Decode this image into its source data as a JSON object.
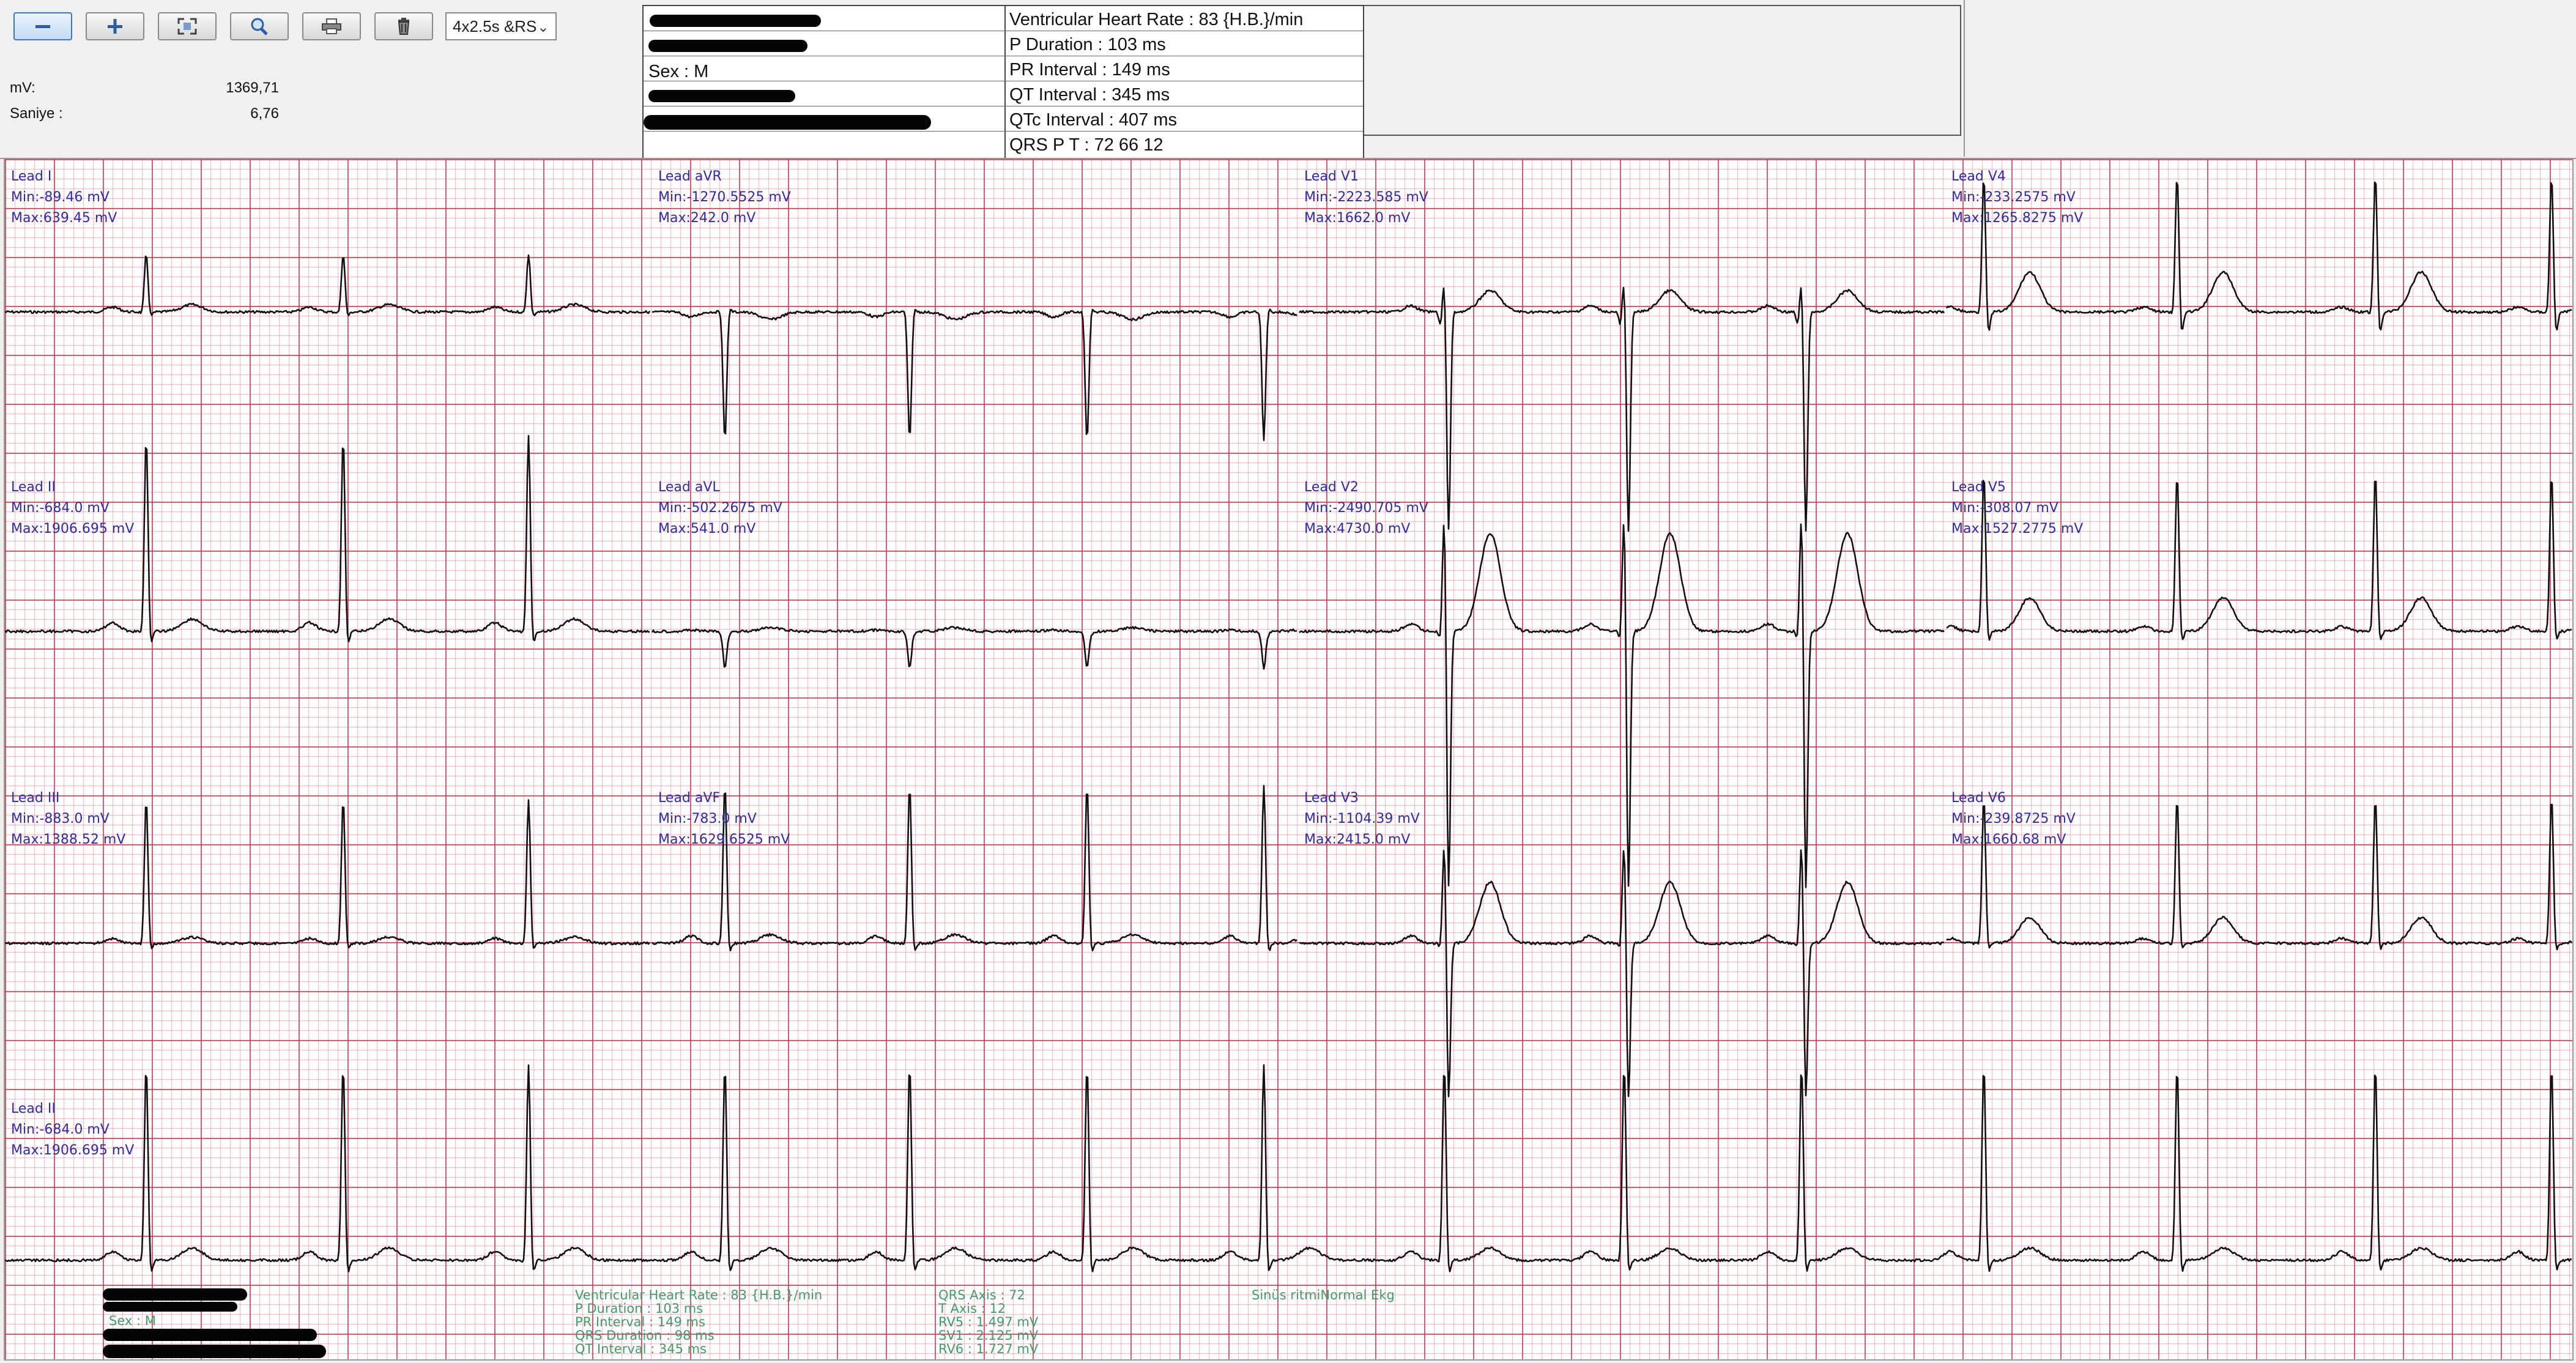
{
  "toolbar": {
    "buttons": [
      {
        "name": "zoom-out-button",
        "icon": "minus-icon"
      },
      {
        "name": "zoom-in-button",
        "icon": "plus-icon"
      },
      {
        "name": "fit-screen-button",
        "icon": "fullscreen-icon"
      },
      {
        "name": "magnify-button",
        "icon": "magnifier-icon"
      },
      {
        "name": "print-button",
        "icon": "printer-icon"
      },
      {
        "name": "delete-button",
        "icon": "trash-icon"
      }
    ],
    "layout_select": "4x2.5s &RS"
  },
  "stats": {
    "mv_label": "mV:",
    "mv_value": "1369,71",
    "saniye_label": "Saniye :",
    "saniye_value": "6,76"
  },
  "info_panel": {
    "sex": "Sex : M",
    "ventricular_rate": "Ventricular Heart Rate : 83 {H.B.}/min",
    "p_duration": "P Duration : 103 ms",
    "pr_interval": "PR Interval : 149 ms",
    "qt_interval": "QT Interval : 345 ms",
    "qtc_interval": "QTc Interval : 407 ms",
    "qrs_pt": "QRS  P  T  : 72  66  12"
  },
  "leads": [
    {
      "label": "Lead I",
      "min": "Min:-89.46 mV",
      "max": "Max:639.45 mV"
    },
    {
      "label": "Lead aVR",
      "min": "Min:-1270.5525 mV",
      "max": "Max:242.0 mV"
    },
    {
      "label": "Lead V1",
      "min": "Min:-2223.585 mV",
      "max": "Max:1662.0 mV"
    },
    {
      "label": "Lead V4",
      "min": "Min:-233.2575 mV",
      "max": "Max:1265.8275 mV"
    },
    {
      "label": "Lead II",
      "min": "Min:-684.0 mV",
      "max": "Max:1906.695 mV"
    },
    {
      "label": "Lead aVL",
      "min": "Min:-502.2675 mV",
      "max": "Max:541.0 mV"
    },
    {
      "label": "Lead V2",
      "min": "Min:-2490.705 mV",
      "max": "Max:4730.0 mV"
    },
    {
      "label": "Lead V5",
      "min": "Min:-308.07 mV",
      "max": "Max:1527.2775 mV"
    },
    {
      "label": "Lead III",
      "min": "Min:-883.0 mV",
      "max": "Max:1388.52 mV"
    },
    {
      "label": "Lead aVF",
      "min": "Min:-783.0 mV",
      "max": "Max:1629.6525 mV"
    },
    {
      "label": "Lead V3",
      "min": "Min:-1104.39 mV",
      "max": "Max:2415.0 mV"
    },
    {
      "label": "Lead V6",
      "min": "Min:-239.8725 mV",
      "max": "Max:1660.68 mV"
    },
    {
      "label": "Lead II",
      "min": "Min:-684.0 mV",
      "max": "Max:1906.695 mV"
    }
  ],
  "report": {
    "sex": "Sex : M",
    "vhr": "Ventricular Heart Rate : 83 {H.B.}/min",
    "p_duration": "P Duration : 103 ms",
    "pr_interval": "PR Interval : 149 ms",
    "qrs_duration": "QRS Duration : 98 ms",
    "qt_interval": "QT Interval : 345 ms",
    "qrs_axis": "QRS Axis : 72",
    "t_axis": "T Axis : 12",
    "rv5": "RV5 : 1.497 mV",
    "sv1": "SV1 : 2.125 mV",
    "rv6": "RV6 : 1.727 mV",
    "interpretation": "Sinüs ritmiNormal Ekg"
  },
  "colors": {
    "grid_major": "#cd3246",
    "grid_minor": "#e68c96",
    "lead_text": "#2a2ab8",
    "report_text": "#3aa06a",
    "trace": "#111111"
  }
}
